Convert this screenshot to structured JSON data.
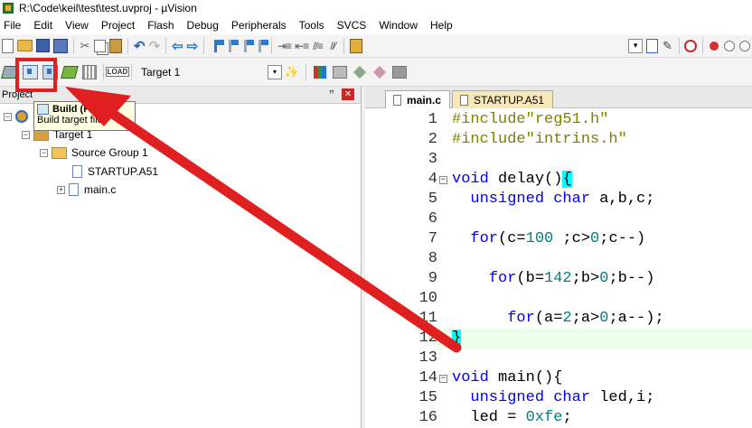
{
  "window": {
    "title": "R:\\Code\\keil\\test\\test.uvproj - µVision"
  },
  "menu": [
    "File",
    "Edit",
    "View",
    "Project",
    "Flash",
    "Debug",
    "Peripherals",
    "Tools",
    "SVCS",
    "Window",
    "Help"
  ],
  "toolbar2": {
    "target": "Target 1"
  },
  "project_panel": {
    "title": "Project",
    "tree": {
      "target": "Target 1",
      "group": "Source Group 1",
      "files": [
        "STARTUP.A51",
        "main.c"
      ]
    }
  },
  "tooltip": {
    "title": "Build (F7)",
    "desc": "Build target files"
  },
  "editor": {
    "tabs": [
      "main.c",
      "STARTUP.A51"
    ],
    "lines": [
      {
        "n": "1",
        "parts": [
          [
            "c-pre",
            "#include\"reg51.h\""
          ]
        ]
      },
      {
        "n": "2",
        "parts": [
          [
            "c-pre",
            "#include\"intrins.h\""
          ]
        ]
      },
      {
        "n": "3",
        "parts": []
      },
      {
        "n": "4",
        "parts": [
          [
            "c-kw",
            "void"
          ],
          [
            "c-txt",
            " delay()"
          ],
          [
            "brace-hl",
            "{"
          ]
        ]
      },
      {
        "n": "5",
        "parts": [
          [
            "c-txt",
            "  "
          ],
          [
            "c-kw",
            "unsigned char"
          ],
          [
            "c-txt",
            " a,b,c;"
          ]
        ]
      },
      {
        "n": "6",
        "parts": []
      },
      {
        "n": "7",
        "parts": [
          [
            "c-txt",
            "  "
          ],
          [
            "c-kw",
            "for"
          ],
          [
            "c-txt",
            "(c="
          ],
          [
            "c-num",
            "100"
          ],
          [
            "c-txt",
            " ;c>"
          ],
          [
            "c-num",
            "0"
          ],
          [
            "c-txt",
            ";c--)"
          ]
        ]
      },
      {
        "n": "8",
        "parts": []
      },
      {
        "n": "9",
        "parts": [
          [
            "c-txt",
            "    "
          ],
          [
            "c-kw",
            "for"
          ],
          [
            "c-txt",
            "(b="
          ],
          [
            "c-num",
            "142"
          ],
          [
            "c-txt",
            ";b>"
          ],
          [
            "c-num",
            "0"
          ],
          [
            "c-txt",
            ";b--)"
          ]
        ]
      },
      {
        "n": "10",
        "parts": []
      },
      {
        "n": "11",
        "parts": [
          [
            "c-txt",
            "      "
          ],
          [
            "c-kw",
            "for"
          ],
          [
            "c-txt",
            "(a="
          ],
          [
            "c-num",
            "2"
          ],
          [
            "c-txt",
            ";a>"
          ],
          [
            "c-num",
            "0"
          ],
          [
            "c-txt",
            ";a--);"
          ]
        ]
      },
      {
        "n": "12",
        "parts": [
          [
            "brace-hl",
            "}"
          ]
        ]
      },
      {
        "n": "13",
        "parts": []
      },
      {
        "n": "14",
        "parts": [
          [
            "c-kw",
            "void"
          ],
          [
            "c-txt",
            " main(){"
          ]
        ]
      },
      {
        "n": "15",
        "parts": [
          [
            "c-txt",
            "  "
          ],
          [
            "c-kw",
            "unsigned char"
          ],
          [
            "c-txt",
            " led,i;"
          ]
        ]
      },
      {
        "n": "16",
        "parts": [
          [
            "c-txt",
            "  led = "
          ],
          [
            "c-num",
            "0xfe"
          ],
          [
            "c-txt",
            ";"
          ]
        ]
      }
    ]
  },
  "colors": {
    "annotation_red": "#e02020",
    "current_line": "#ebfeeb",
    "brace_match": "#00ffff"
  }
}
